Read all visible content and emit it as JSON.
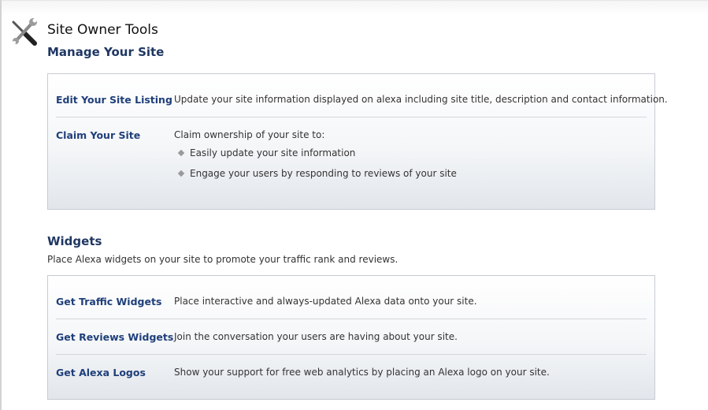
{
  "header": {
    "title": "Site Owner Tools",
    "icon": "tools-icon"
  },
  "manage": {
    "heading": "Manage Your Site",
    "edit_listing": {
      "link": "Edit Your Site Listing",
      "text": "Update your site information displayed on alexa including site title, description and contact information."
    },
    "claim": {
      "link": "Claim Your Site",
      "text": "Claim ownership of your site to:",
      "bullets": [
        "Easily update your site information",
        "Engage your users by responding to reviews of your site"
      ]
    }
  },
  "widgets": {
    "heading": "Widgets",
    "description": "Place Alexa widgets on your site to promote your traffic rank and reviews.",
    "items": [
      {
        "link": "Get Traffic Widgets",
        "text": "Place interactive and always-updated Alexa data onto your site."
      },
      {
        "link": "Get Reviews Widgets",
        "text": "Join the conversation your users are having about your site."
      },
      {
        "link": "Get Alexa Logos",
        "text": "Show your support for free web analytics by placing an Alexa logo on your site."
      }
    ]
  },
  "colors": {
    "link": "#1f3f7a",
    "heading": "#1f3763",
    "panel_border": "#c6ccd4"
  }
}
